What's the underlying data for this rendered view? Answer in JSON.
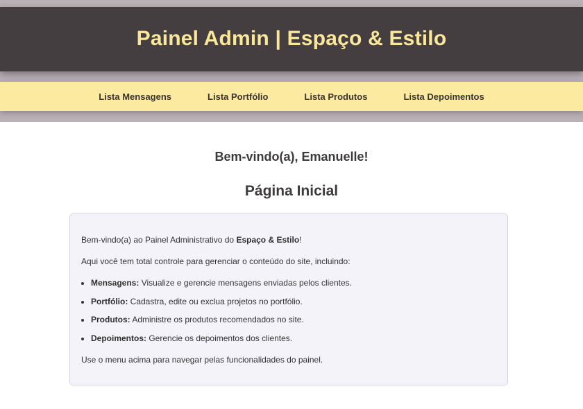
{
  "header": {
    "title": "Painel Admin | Espaço & Estilo"
  },
  "nav": {
    "items": [
      {
        "label": "Lista Mensagens"
      },
      {
        "label": "Lista Portfólio"
      },
      {
        "label": "Lista Produtos"
      },
      {
        "label": "Lista Depoimentos"
      }
    ]
  },
  "main": {
    "welcome": "Bem-vindo(a), Emanuelle!",
    "page_title": "Página Inicial",
    "card": {
      "intro_prefix": "Bem-vindo(a) ao Painel Administrativo do ",
      "intro_brand": "Espaço & Estilo",
      "intro_suffix": "!",
      "lead": "Aqui você tem total controle para gerenciar o conteúdo do site, incluindo:",
      "items": [
        {
          "term": "Mensagens:",
          "desc": " Visualize e gerencie mensagens enviadas pelos clientes."
        },
        {
          "term": "Portfólio:",
          "desc": " Cadastra, edite ou exclua projetos no portfólio."
        },
        {
          "term": "Produtos:",
          "desc": " Administre os produtos recomendados no site."
        },
        {
          "term": "Depoimentos:",
          "desc": " Gerencie os depoimentos dos clientes."
        }
      ],
      "footer": "Use o menu acima para navegar pelas funcionalidades do painel."
    }
  },
  "colors": {
    "header_bg": "#453e41",
    "header_text": "#fbe79a",
    "nav_bg": "#fbea9f",
    "band_bg": "#b9b1b6",
    "card_bg": "#f4f3f9"
  }
}
